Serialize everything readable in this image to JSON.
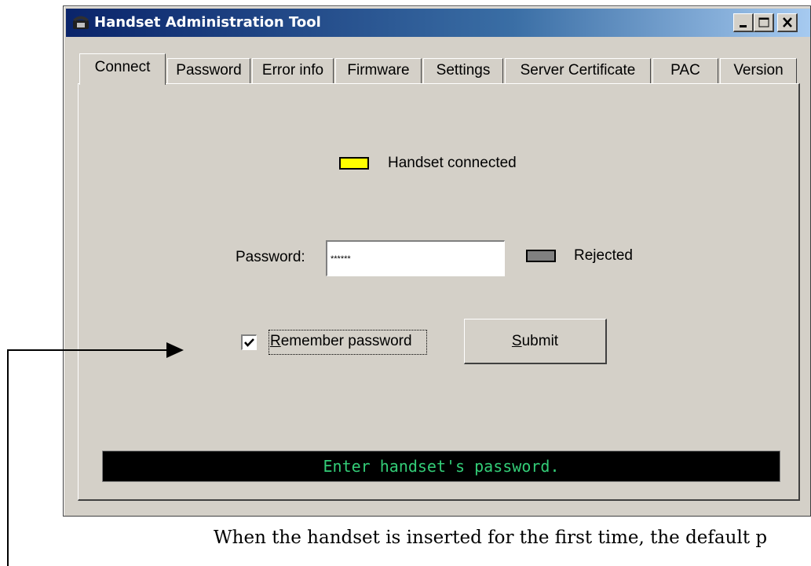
{
  "window": {
    "title": "Handset Administration Tool",
    "controls": {
      "minimize": "_",
      "maximize": "□",
      "close": "×"
    }
  },
  "tabs": [
    {
      "label": "Connect",
      "active": true
    },
    {
      "label": "Password"
    },
    {
      "label": "Error info"
    },
    {
      "label": "Firmware"
    },
    {
      "label": "Settings"
    },
    {
      "label": "Server Certificate"
    },
    {
      "label": "PAC"
    },
    {
      "label": "Version"
    }
  ],
  "connect": {
    "handset_status_label": "Handset connected",
    "handset_led_color": "#ffff00",
    "password_label": "Password:",
    "password_value": "******",
    "rejected_label": "Rejected",
    "rejected_led_color": "#808080",
    "remember_label": "Remember password",
    "remember_checked": true,
    "submit_label": "Submit",
    "status_message": "Enter handset's password.",
    "status_text_color": "#33cc77"
  },
  "caption": "When the handset is inserted for the first time, the default p"
}
